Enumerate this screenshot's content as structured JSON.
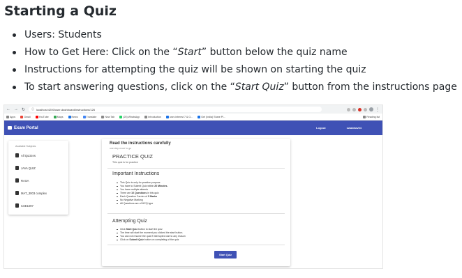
{
  "doc": {
    "title": "Starting a Quiz",
    "bullets": [
      {
        "text": "Users: Students"
      },
      {
        "before": "How to Get Here: Click on the “",
        "em": "Start",
        "after": "” button below the quiz name"
      },
      {
        "text": "Instructions for attempting the quiz will be shown on starting the quiz"
      },
      {
        "before": "To start answering questions, click on the “",
        "em": "Start Quiz",
        "after": "” button from the instructions page"
      }
    ]
  },
  "browser": {
    "url": "localhost:4200/user-dashboard/instructions/126",
    "bookmarks": [
      {
        "label": "Apps",
        "icon": "apps-icon"
      },
      {
        "label": "Gmail",
        "icon": "gmail-icon"
      },
      {
        "label": "YouTube",
        "icon": "youtube-icon"
      },
      {
        "label": "Maps",
        "icon": "maps-icon"
      },
      {
        "label": "News",
        "icon": "news-icon"
      },
      {
        "label": "Translate",
        "icon": "translate-icon"
      },
      {
        "label": "New Tab",
        "icon": "newtab-icon"
      },
      {
        "label": "(25) WhatsApp",
        "icon": "whatsapp-icon"
      },
      {
        "label": "Introduction",
        "icon": "page-icon"
      },
      {
        "label": "user-interest 7 & G...",
        "icon": "page-icon"
      },
      {
        "label": "Get (India) Share Pl...",
        "icon": "page-icon"
      }
    ],
    "reading_list": "Reading list"
  },
  "app": {
    "brand": "Exam Portal",
    "logout": "Logout",
    "username": "swabhav04"
  },
  "sidebar": {
    "heading": "Available Subjects",
    "items": [
      "All Quizzes",
      "JAVA QUIZ",
      "RASA",
      "MAT_3003 complex",
      "CSE1007"
    ]
  },
  "instructions": {
    "title": "Read the instructions carefully",
    "subtitle": "one step more to go",
    "quiz_name": "PRACTICE QUIZ",
    "quiz_desc": "This quiz is for practice",
    "important_title": "Important Instructions",
    "important_items": [
      {
        "text": "This Quiz is only for practice purpose"
      },
      {
        "before": "You have to Submit Quiz within ",
        "bold": "20 Minutes.",
        "after": ""
      },
      {
        "text": "You have multiple attemts"
      },
      {
        "before": "There are ",
        "bold": "10 Questions",
        "after": " in this quiz"
      },
      {
        "before": "Each Question Carries of ",
        "bold": "5 Marks",
        "after": ""
      },
      {
        "text": "No Negative Marking"
      },
      {
        "text": "All Questions are of MCQ type"
      }
    ],
    "attempting_title": "Attempting Quiz",
    "attempting_items": [
      {
        "before": "Click ",
        "bold": "Start Quiz",
        "after": " button to start the quiz"
      },
      {
        "text": "The time will start the moment you clicked the start button."
      },
      {
        "text": "You can not resume the quiz if interrupted due to any reason"
      },
      {
        "before": "Click on ",
        "bold": "Submit Quiz",
        "after": " button on completing of the quiz"
      }
    ],
    "start_button": "Start Quiz"
  }
}
